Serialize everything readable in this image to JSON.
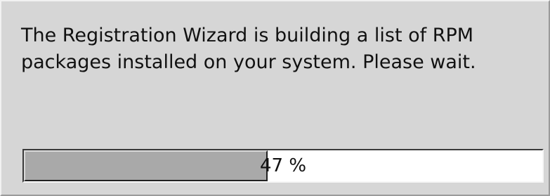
{
  "dialog": {
    "message_lines": [
      "The Registration Wizard is building a list of RPM",
      "packages installed on your system. Please wait."
    ],
    "progress": {
      "fraction": 0.47,
      "label": "47 %"
    }
  },
  "colors": {
    "background": "#d6d6d6",
    "progress_fill": "#a9a9a9",
    "progress_track": "#ffffff",
    "text": "#111111"
  }
}
